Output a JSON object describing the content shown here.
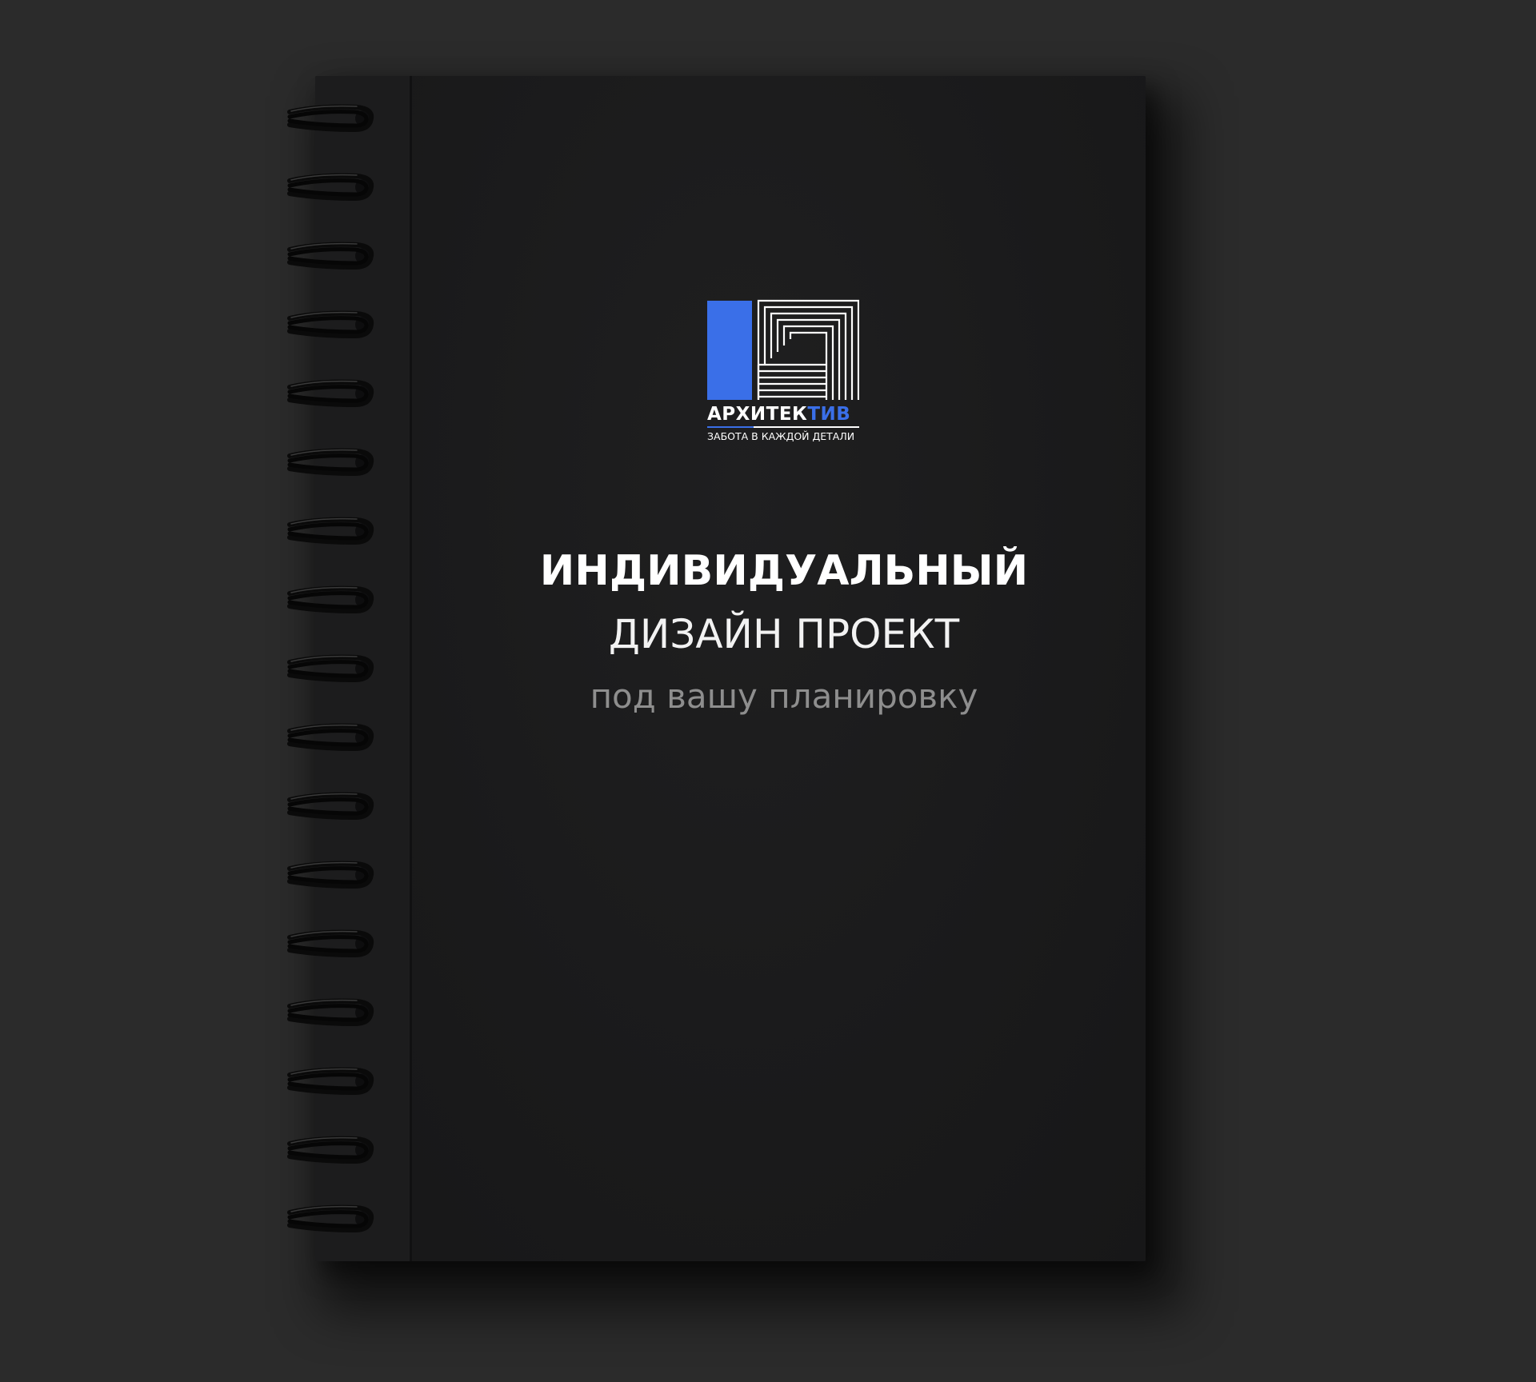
{
  "brand": {
    "name_main": "АРХИТЕК",
    "name_accent": "ТИВ",
    "tagline": "ЗАБОТА В КАЖДОЙ ДЕТАЛИ",
    "accent_color": "#3a6fe8"
  },
  "cover": {
    "title_line1": "ИНДИВИДУАЛЬНЫЙ",
    "title_line2": "ДИЗАЙН ПРОЕКТ",
    "subtitle": "под вашу планировку"
  },
  "colors": {
    "background": "#2b2b2b",
    "notebook": "#1a1a1b",
    "text": "#ffffff",
    "subtitle": "#8e8e8e"
  },
  "binding": {
    "ring_count": 17,
    "icon": "spiral-ring-icon"
  }
}
